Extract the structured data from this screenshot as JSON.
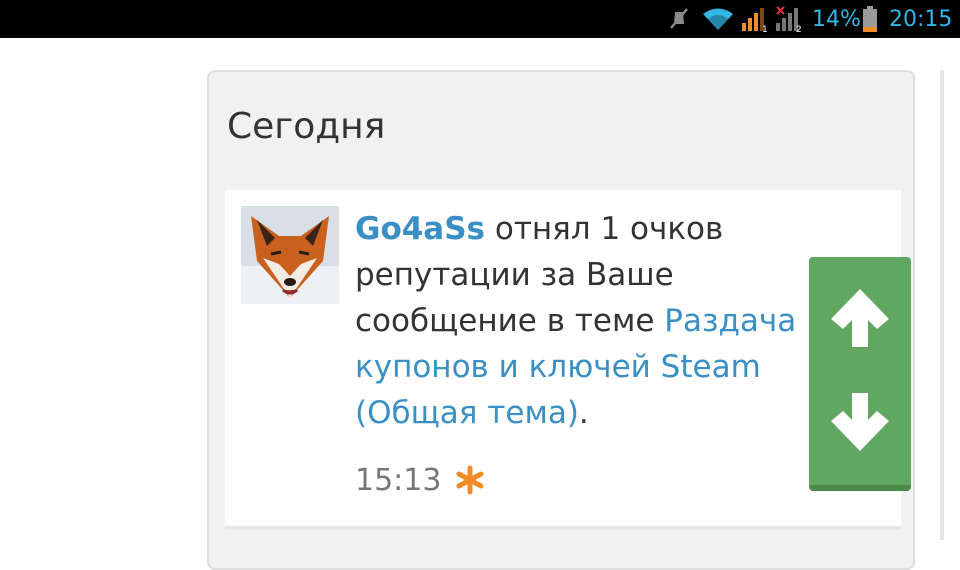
{
  "status_bar": {
    "battery_percent": "14%",
    "clock": "20:15",
    "sim1_label": "1",
    "sim2_label": "2",
    "icons": [
      "mute-icon",
      "wifi-icon",
      "signal-sim1-icon",
      "signal-sim2-icon",
      "battery-icon"
    ],
    "accent_color": "#33b5e5"
  },
  "section": {
    "title": "Сегодня"
  },
  "notification": {
    "username": "Go4aSs",
    "action_text": " отнял 1 очков репутации за Ваше сообщение в теме ",
    "topic": "Раздача купонов и ключей Steam (Общая тема)",
    "trailing": ".",
    "time": "15:13",
    "link_color": "#3a8fc4"
  },
  "scroll_controls": {
    "up_icon": "arrow-up-icon",
    "down_icon": "arrow-down-icon",
    "color": "#61a761"
  }
}
